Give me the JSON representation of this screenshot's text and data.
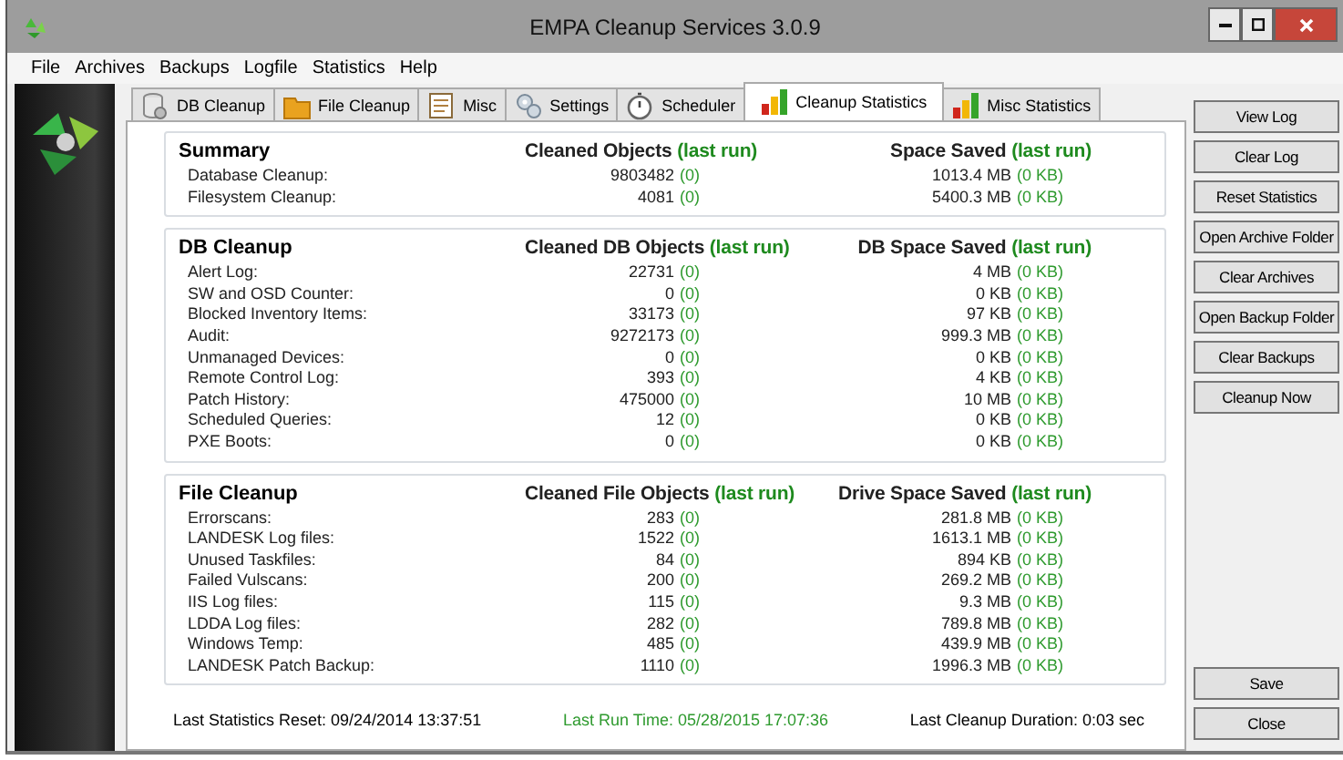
{
  "window": {
    "title": "EMPA Cleanup Services 3.0.9"
  },
  "menu": [
    "File",
    "Archives",
    "Backups",
    "Logfile",
    "Statistics",
    "Help"
  ],
  "tabs": [
    {
      "label": "DB Cleanup",
      "selected": false
    },
    {
      "label": "File Cleanup",
      "selected": false
    },
    {
      "label": "Misc",
      "selected": false
    },
    {
      "label": "Settings",
      "selected": false
    },
    {
      "label": "Scheduler",
      "selected": false
    },
    {
      "label": "Cleanup Statistics",
      "selected": true
    },
    {
      "label": "Misc Statistics",
      "selected": false
    }
  ],
  "sections": [
    {
      "title": "Summary",
      "count_header": "Cleaned Objects",
      "space_header": "Space Saved",
      "last_run_label": "(last run)",
      "last_run_label_2": "(last run)",
      "rows": [
        {
          "label": "Database Cleanup:",
          "count": "9803482",
          "count_last": "(0)",
          "space": "1013.4 MB",
          "space_last": "(0 KB)"
        },
        {
          "label": "Filesystem Cleanup:",
          "count": "4081",
          "count_last": "(0)",
          "space": "5400.3 MB",
          "space_last": "(0 KB)"
        }
      ]
    },
    {
      "title": "DB Cleanup",
      "count_header": "Cleaned DB Objects",
      "space_header": "DB Space Saved",
      "last_run_label": "(last run)",
      "last_run_label_2": "(last run)",
      "rows": [
        {
          "label": "Alert Log:",
          "count": "22731",
          "count_last": "(0)",
          "space": "4 MB",
          "space_last": "(0 KB)"
        },
        {
          "label": "SW and OSD Counter:",
          "count": "0",
          "count_last": "(0)",
          "space": "0 KB",
          "space_last": "(0 KB)"
        },
        {
          "label": "Blocked Inventory Items:",
          "count": "33173",
          "count_last": "(0)",
          "space": "97 KB",
          "space_last": "(0 KB)"
        },
        {
          "label": "Audit:",
          "count": "9272173",
          "count_last": "(0)",
          "space": "999.3 MB",
          "space_last": "(0 KB)"
        },
        {
          "label": "Unmanaged Devices:",
          "count": "0",
          "count_last": "(0)",
          "space": "0 KB",
          "space_last": "(0 KB)"
        },
        {
          "label": "Remote Control Log:",
          "count": "393",
          "count_last": "(0)",
          "space": "4 KB",
          "space_last": "(0 KB)"
        },
        {
          "label": "Patch History:",
          "count": "475000",
          "count_last": "(0)",
          "space": "10 MB",
          "space_last": "(0 KB)"
        },
        {
          "label": "Scheduled Queries:",
          "count": "12",
          "count_last": "(0)",
          "space": "0 KB",
          "space_last": "(0 KB)"
        },
        {
          "label": "PXE Boots:",
          "count": "0",
          "count_last": "(0)",
          "space": "0 KB",
          "space_last": "(0 KB)"
        }
      ]
    },
    {
      "title": "File Cleanup",
      "count_header": "Cleaned File Objects",
      "space_header": "Drive Space Saved",
      "last_run_label": "(last run)",
      "last_run_label_2": "(last run)",
      "rows": [
        {
          "label": "Errorscans:",
          "count": "283",
          "count_last": "(0)",
          "space": "281.8 MB",
          "space_last": "(0 KB)"
        },
        {
          "label": "LANDESK Log files:",
          "count": "1522",
          "count_last": "(0)",
          "space": "1613.1 MB",
          "space_last": "(0 KB)"
        },
        {
          "label": "Unused Taskfiles:",
          "count": "84",
          "count_last": "(0)",
          "space": "894 KB",
          "space_last": "(0 KB)"
        },
        {
          "label": "Failed Vulscans:",
          "count": "200",
          "count_last": "(0)",
          "space": "269.2 MB",
          "space_last": "(0 KB)"
        },
        {
          "label": "IIS Log files:",
          "count": "115",
          "count_last": "(0)",
          "space": "9.3 MB",
          "space_last": "(0 KB)"
        },
        {
          "label": "LDDA Log files:",
          "count": "282",
          "count_last": "(0)",
          "space": "789.8 MB",
          "space_last": "(0 KB)"
        },
        {
          "label": "Windows Temp:",
          "count": "485",
          "count_last": "(0)",
          "space": "439.9 MB",
          "space_last": "(0 KB)"
        },
        {
          "label": "LANDESK Patch Backup:",
          "count": "1110",
          "count_last": "(0)",
          "space": "1996.3 MB",
          "space_last": "(0 KB)"
        }
      ]
    }
  ],
  "footer": {
    "last_reset": "Last Statistics Reset: 09/24/2014 13:37:51",
    "last_run": "Last Run Time: 05/28/2015 17:07:36",
    "duration": "Last Cleanup Duration: 0:03 sec"
  },
  "actions": [
    "View Log",
    "Clear Log",
    "Reset Statistics",
    "Open Archive Folder",
    "Clear Archives",
    "Open Backup Folder",
    "Clear Backups",
    "Cleanup Now"
  ],
  "bottom_actions": [
    "Save",
    "Close"
  ]
}
